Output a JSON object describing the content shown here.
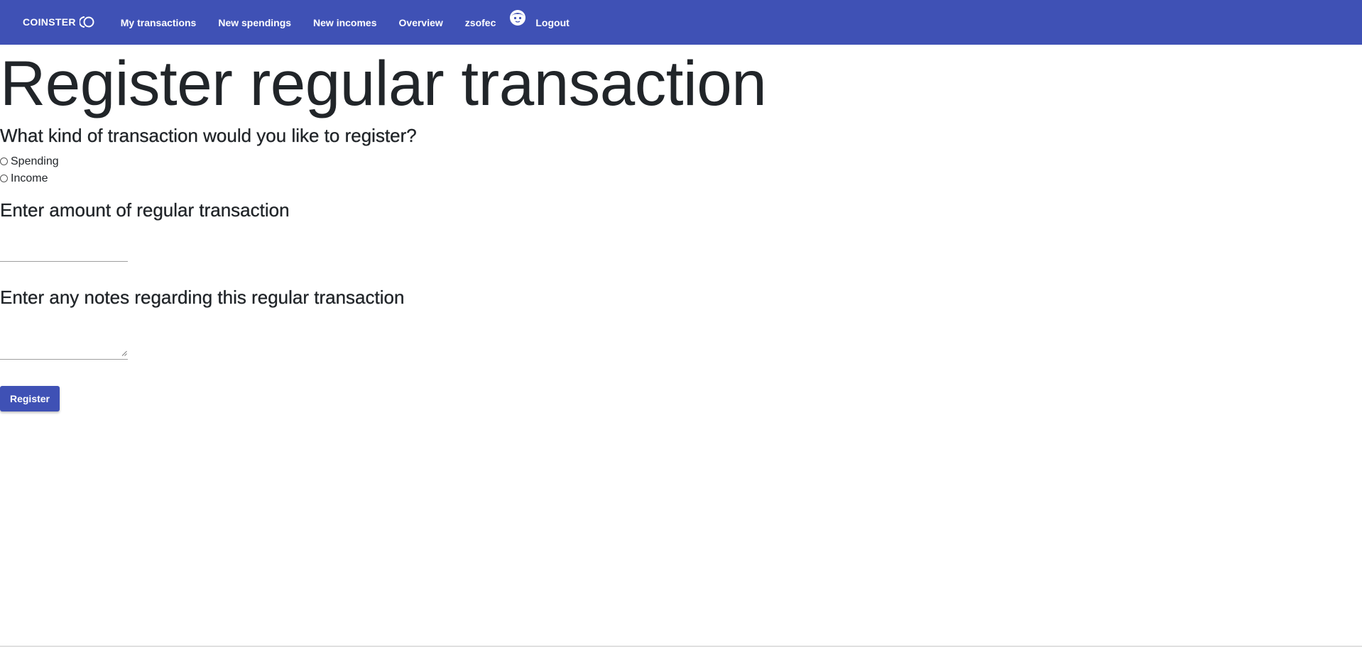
{
  "navbar": {
    "brand": "COINSTER",
    "brand_icon": "coin-logo-icon",
    "items": [
      {
        "label": "My transactions"
      },
      {
        "label": "New spendings"
      },
      {
        "label": "New incomes"
      },
      {
        "label": "Overview"
      },
      {
        "label": "zsofec"
      }
    ],
    "avatar_icon": "user-avatar-icon",
    "logout_label": "Logout",
    "color": "#3f51b5"
  },
  "page": {
    "title": "Register regular transaction"
  },
  "form": {
    "type_question": "What kind of transaction would you like to register?",
    "type_options": [
      {
        "label": "Spending",
        "checked": false
      },
      {
        "label": "Income",
        "checked": false
      }
    ],
    "amount_heading": "Enter amount of regular transaction",
    "amount_value": "",
    "notes_heading": "Enter any notes regarding this regular transaction",
    "notes_value": "",
    "submit_label": "Register"
  }
}
